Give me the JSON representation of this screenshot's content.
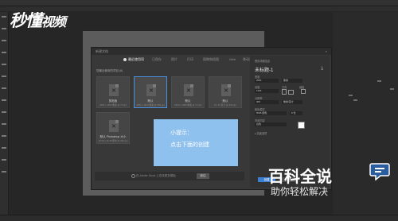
{
  "watermark_top_left": {
    "brand": "秒懂",
    "suffix": "视频"
  },
  "dialog": {
    "title": "新建文档",
    "close": "×",
    "tabs": [
      "最近使用项",
      "已保存",
      "照片",
      "打印",
      "图稿和插图",
      "Web",
      "移动设备",
      "胶片和视频"
    ],
    "active_tab_index": 0,
    "section_label": "您最近使用的项目 (6)",
    "tiles": [
      {
        "name": "剪贴板",
        "sub": "2051 x 1154 像素 @ 72 ppi"
      },
      {
        "name": "默认",
        "sub": "2051 x 1154 像素 @ 300 ppi"
      },
      {
        "name": "默认",
        "sub": "1920 x 1080 像素 @ 72 ppi"
      },
      {
        "name": "默认",
        "sub": "8 x 10 英寸 @ 300 ppi"
      },
      {
        "name": "默认 Photoshop 大小",
        "sub": "16.93 x 11.99 厘米 @ 300 ppi"
      }
    ],
    "tip": {
      "line1": "小提示：",
      "line2": "点击下面的创建"
    },
    "search": {
      "placeholder": "在 Adobe Stock 上查找更多模板",
      "button": "前往"
    },
    "props": {
      "header": "预设详细信息",
      "doc_name": "未标题-1",
      "width_label": "宽度",
      "width_value": "2051",
      "width_unit": "像素",
      "height_label": "高度",
      "height_value": "1154",
      "orientation_label": "方向",
      "artboard_label": "画板",
      "resolution_label": "分辨率",
      "resolution_value": "300",
      "resolution_unit": "像素/英寸",
      "color_mode_label": "颜色模式",
      "color_mode_value": "RGB 颜色",
      "bit_depth": "8 位",
      "background_label": "背景内容",
      "background_value": "白色",
      "advanced_label": "高级选项",
      "create_button": "创建",
      "close_button": "关闭"
    }
  },
  "watermark_bottom_right": {
    "line1": "百科全说",
    "line2": "助你轻松解决"
  },
  "colors": {
    "tip_bg": "#8fc1ee",
    "selected_border": "#4a90e2",
    "create_button": "#3d7fd1"
  }
}
